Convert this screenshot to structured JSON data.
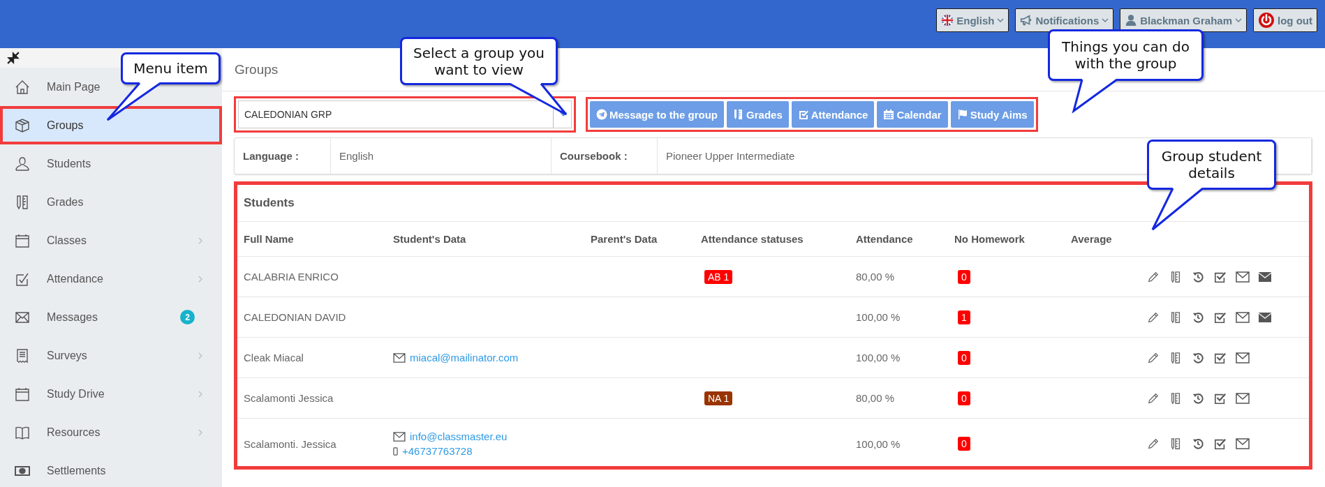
{
  "top_bar": {
    "items": [
      {
        "label": "English",
        "has_menu": true
      },
      {
        "label": "Notifications",
        "has_menu": true
      },
      {
        "label": "Blackman Graham",
        "has_menu": true
      },
      {
        "label": "log out",
        "has_menu": false
      }
    ]
  },
  "sidebar": {
    "items": [
      {
        "label": "Main Page",
        "selected": false,
        "highlighted": false,
        "expandable": false
      },
      {
        "label": "Groups",
        "selected": true,
        "highlighted": true,
        "expandable": false
      },
      {
        "label": "Students",
        "selected": false,
        "highlighted": false,
        "expandable": false
      },
      {
        "label": "Grades",
        "selected": false,
        "highlighted": false,
        "expandable": false
      },
      {
        "label": "Classes",
        "selected": false,
        "highlighted": false,
        "expandable": true
      },
      {
        "label": "Attendance",
        "selected": false,
        "highlighted": false,
        "expandable": true
      },
      {
        "label": "Messages",
        "selected": false,
        "highlighted": false,
        "expandable": false,
        "badge": "2"
      },
      {
        "label": "Surveys",
        "selected": false,
        "highlighted": false,
        "expandable": true
      },
      {
        "label": "Study Drive",
        "selected": false,
        "highlighted": false,
        "expandable": true
      },
      {
        "label": "Resources",
        "selected": false,
        "highlighted": false,
        "expandable": true
      },
      {
        "label": "Settlements",
        "selected": false,
        "highlighted": false,
        "expandable": false
      }
    ]
  },
  "page": {
    "title": "Groups"
  },
  "group_selector": {
    "value": "CALEDONIAN GRP",
    "highlighted": true
  },
  "group_actions": {
    "highlighted": true,
    "buttons": [
      "Message to the group",
      "Grades",
      "Attendance",
      "Calendar",
      "Study Aims"
    ]
  },
  "group_info": [
    {
      "label": "Language :",
      "value": "English"
    },
    {
      "label": "Coursebook :",
      "value": "Pioneer Upper Intermediate"
    }
  ],
  "students": {
    "title": "Students",
    "highlighted": true,
    "columns": [
      "Full Name",
      "Student's Data",
      "Parent's Data",
      "Attendance statuses",
      "Attendance",
      "No Homework",
      "Average"
    ],
    "rows": [
      {
        "full_name": "CALABRIA ENRICO",
        "attendance_status": {
          "text": "AB 1",
          "color": "#ff0000"
        },
        "attendance": "80,00 %",
        "no_homework": "0",
        "parent_message": true
      },
      {
        "full_name": "CALEDONIAN DAVID",
        "attendance": "100,00 %",
        "no_homework": "1",
        "parent_message": true
      },
      {
        "full_name": "Cleak Miacal",
        "email": "miacal@mailinator.com",
        "attendance": "100,00 %",
        "no_homework": "0",
        "parent_message": false
      },
      {
        "full_name": "Scalamonti Jessica",
        "attendance_status": {
          "text": "NA 1",
          "color": "#993300"
        },
        "attendance": "80,00 %",
        "no_homework": "0",
        "parent_message": false
      },
      {
        "full_name": "Scalamonti. Jessica",
        "email": "info@classmaster.eu",
        "phone": "+46737763728",
        "attendance": "100,00 %",
        "no_homework": "0",
        "parent_message": false
      }
    ]
  },
  "callouts": [
    {
      "text": "Menu item"
    },
    {
      "text": "Select a group you want to view"
    },
    {
      "text": "Things you can do with the group"
    },
    {
      "text": "Group student details"
    }
  ]
}
